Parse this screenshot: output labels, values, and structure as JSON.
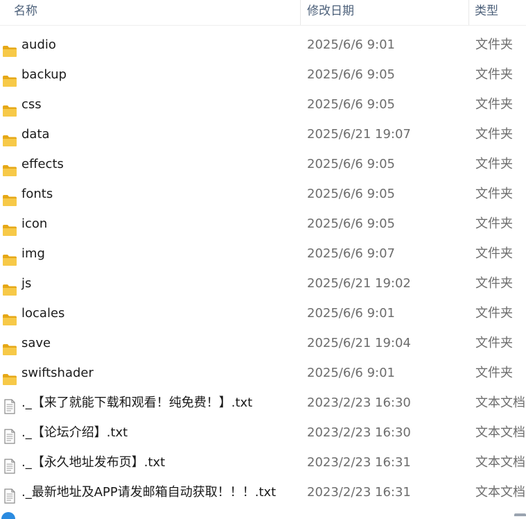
{
  "columns": {
    "name": "名称",
    "date": "修改日期",
    "type": "类型"
  },
  "files": [
    {
      "name": "audio",
      "date": "2025/6/6 9:01",
      "type": "文件夹",
      "icon": "folder-icon"
    },
    {
      "name": "backup",
      "date": "2025/6/6 9:05",
      "type": "文件夹",
      "icon": "folder-icon"
    },
    {
      "name": "css",
      "date": "2025/6/6 9:05",
      "type": "文件夹",
      "icon": "folder-icon"
    },
    {
      "name": "data",
      "date": "2025/6/21 19:07",
      "type": "文件夹",
      "icon": "folder-icon"
    },
    {
      "name": "effects",
      "date": "2025/6/6 9:05",
      "type": "文件夹",
      "icon": "folder-icon"
    },
    {
      "name": "fonts",
      "date": "2025/6/6 9:05",
      "type": "文件夹",
      "icon": "folder-icon"
    },
    {
      "name": "icon",
      "date": "2025/6/6 9:05",
      "type": "文件夹",
      "icon": "folder-icon"
    },
    {
      "name": "img",
      "date": "2025/6/6 9:07",
      "type": "文件夹",
      "icon": "folder-icon"
    },
    {
      "name": "js",
      "date": "2025/6/21 19:02",
      "type": "文件夹",
      "icon": "folder-icon"
    },
    {
      "name": "locales",
      "date": "2025/6/6 9:01",
      "type": "文件夹",
      "icon": "folder-icon"
    },
    {
      "name": "save",
      "date": "2025/6/21 19:04",
      "type": "文件夹",
      "icon": "folder-icon"
    },
    {
      "name": "swiftshader",
      "date": "2025/6/6 9:01",
      "type": "文件夹",
      "icon": "folder-icon"
    },
    {
      "name": "._【来了就能下载和观看！纯免费！】.txt",
      "date": "2023/2/23 16:30",
      "type": "文本文档",
      "icon": "text-file-icon"
    },
    {
      "name": "._【论坛介绍】.txt",
      "date": "2023/2/23 16:30",
      "type": "文本文档",
      "icon": "text-file-icon"
    },
    {
      "name": "._【永久地址发布页】.txt",
      "date": "2023/2/23 16:31",
      "type": "文本文档",
      "icon": "text-file-icon"
    },
    {
      "name": "._最新地址及APP请发邮箱自动获取！！！.txt",
      "date": "2023/2/23 16:31",
      "type": "文本文档",
      "icon": "text-file-icon"
    }
  ],
  "colors": {
    "folder": "#f7c948",
    "folder_dark": "#e6a817",
    "header_text": "#4c607a",
    "secondary_text": "#6d6d6d"
  }
}
